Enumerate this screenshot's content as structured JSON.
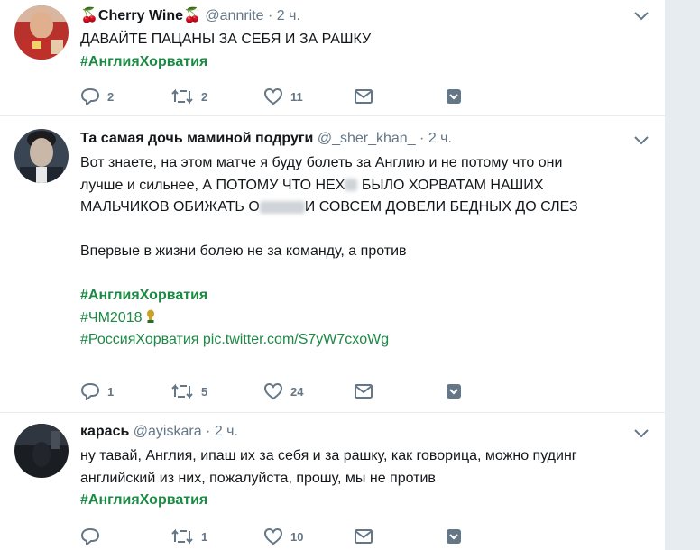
{
  "tweets": [
    {
      "name": "Cherry Wine",
      "handle": "@annrite",
      "time": "· 2 ч.",
      "line1": "ДАВАЙТЕ ПАЦАНЫ ЗА СЕБЯ И ЗА РАШКУ",
      "hashtag": "#АнглияХорватия",
      "replies": "2",
      "retweets": "2",
      "likes": "11"
    },
    {
      "name": "Та самая дочь маминой подруги",
      "handle": "@_sher_khan_",
      "time": "· 2 ч.",
      "line1": "Вот знаете, на этом матче я буду болеть за Англию и не потому что они",
      "line2a": "лучше и сильнее, А ПОТОМУ ЧТО НЕХ",
      "line2b": " БЫЛО ХОРВАТАМ НАШИХ",
      "line3a": "МАЛЬЧИКОВ ОБИЖАТЬ О",
      "line3b": "И СОВСЕМ ДОВЕЛИ БЕДНЫХ ДО СЛЕЗ",
      "line4": "Впервые в жизни болею не за команду, а против",
      "hashtag1": "#АнглияХорватия",
      "hashtag2": "#ЧМ2018",
      "hashtag3": "#РоссияХорватия",
      "link": "pic.twitter.com/S7yW7cxoWg",
      "replies": "1",
      "retweets": "5",
      "likes": "24"
    },
    {
      "name": "карась",
      "handle": "@ayiskara",
      "time": "· 2 ч.",
      "line1": "ну тавай, Англия, ипаш их за себя и за рашку, как говорица, можно пудинг",
      "line2": "английский из них, пожалуйста, прошу, мы не против",
      "hashtag": "#АнглияХорватия",
      "replies": "",
      "retweets": "1",
      "likes": "10"
    }
  ],
  "icons": {
    "reply": "reply-icon",
    "retweet": "retweet-icon",
    "like": "heart-icon",
    "dm": "envelope-icon",
    "bookmark": "bookmark-icon",
    "more": "chevron-down-icon",
    "emoji": "cherry-emoji"
  },
  "colors": {
    "hashtag": "#1b8a44",
    "meta": "#657786",
    "icon": "#657786"
  }
}
